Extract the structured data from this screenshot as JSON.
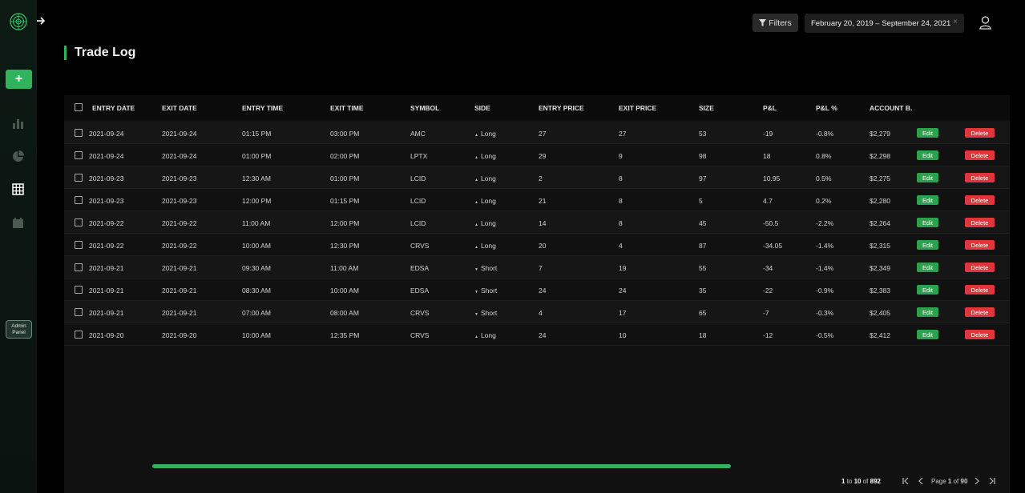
{
  "header": {
    "filters_label": "Filters",
    "date_range": "February 20, 2019 – September 24, 2021",
    "clear_symbol": "×"
  },
  "sidebar": {
    "add_label": "+",
    "admin_label": "Admin Panel",
    "icons": [
      "bar-chart-icon",
      "pie-chart-icon",
      "table-grid-icon",
      "calendar-icon"
    ]
  },
  "page": {
    "title": "Trade Log"
  },
  "table": {
    "columns": [
      "ENTRY DATE",
      "EXIT DATE",
      "ENTRY TIME",
      "EXIT TIME",
      "SYMBOL",
      "SIDE",
      "ENTRY PRICE",
      "EXIT PRICE",
      "SIZE",
      "P&L",
      "P&L %",
      "ACCOUNT B."
    ],
    "edit_label": "Edit",
    "delete_label": "Delete",
    "rows": [
      {
        "entry_date": "2021-09-24",
        "exit_date": "2021-09-24",
        "entry_time": "01:15 PM",
        "exit_time": "03:00 PM",
        "symbol": "AMC",
        "side_mark": "▲",
        "side": "Long",
        "entry_price": "27",
        "exit_price": "27",
        "size": "53",
        "pnl": "-19",
        "pnl_pct": "-0.8%",
        "account": "$2,279"
      },
      {
        "entry_date": "2021-09-24",
        "exit_date": "2021-09-24",
        "entry_time": "01:00 PM",
        "exit_time": "02:00 PM",
        "symbol": "LPTX",
        "side_mark": "▲",
        "side": "Long",
        "entry_price": "29",
        "exit_price": "9",
        "size": "98",
        "pnl": "18",
        "pnl_pct": "0.8%",
        "account": "$2,298"
      },
      {
        "entry_date": "2021-09-23",
        "exit_date": "2021-09-23",
        "entry_time": "12:30 AM",
        "exit_time": "01:00 PM",
        "symbol": "LCID",
        "side_mark": "▲",
        "side": "Long",
        "entry_price": "2",
        "exit_price": "8",
        "size": "97",
        "pnl": "10.95",
        "pnl_pct": "0.5%",
        "account": "$2,275"
      },
      {
        "entry_date": "2021-09-23",
        "exit_date": "2021-09-23",
        "entry_time": "12:00 PM",
        "exit_time": "01:15 PM",
        "symbol": "LCID",
        "side_mark": "▲",
        "side": "Long",
        "entry_price": "21",
        "exit_price": "8",
        "size": "5",
        "pnl": "4.7",
        "pnl_pct": "0.2%",
        "account": "$2,280"
      },
      {
        "entry_date": "2021-09-22",
        "exit_date": "2021-09-22",
        "entry_time": "11:00 AM",
        "exit_time": "12:00 PM",
        "symbol": "LCID",
        "side_mark": "▲",
        "side": "Long",
        "entry_price": "14",
        "exit_price": "8",
        "size": "45",
        "pnl": "-50.5",
        "pnl_pct": "-2.2%",
        "account": "$2,264"
      },
      {
        "entry_date": "2021-09-22",
        "exit_date": "2021-09-22",
        "entry_time": "10:00 AM",
        "exit_time": "12:30 PM",
        "symbol": "CRVS",
        "side_mark": "▲",
        "side": "Long",
        "entry_price": "20",
        "exit_price": "4",
        "size": "87",
        "pnl": "-34.05",
        "pnl_pct": "-1.4%",
        "account": "$2,315"
      },
      {
        "entry_date": "2021-09-21",
        "exit_date": "2021-09-21",
        "entry_time": "09:30 AM",
        "exit_time": "11:00 AM",
        "symbol": "EDSA",
        "side_mark": "▼",
        "side": "Short",
        "entry_price": "7",
        "exit_price": "19",
        "size": "55",
        "pnl": "-34",
        "pnl_pct": "-1.4%",
        "account": "$2,349"
      },
      {
        "entry_date": "2021-09-21",
        "exit_date": "2021-09-21",
        "entry_time": "08:30 AM",
        "exit_time": "10:00 AM",
        "symbol": "EDSA",
        "side_mark": "▼",
        "side": "Short",
        "entry_price": "24",
        "exit_price": "24",
        "size": "35",
        "pnl": "-22",
        "pnl_pct": "-0.9%",
        "account": "$2,383"
      },
      {
        "entry_date": "2021-09-21",
        "exit_date": "2021-09-21",
        "entry_time": "07:00 AM",
        "exit_time": "08:00 AM",
        "symbol": "CRVS",
        "side_mark": "▼",
        "side": "Short",
        "entry_price": "4",
        "exit_price": "17",
        "size": "65",
        "pnl": "-7",
        "pnl_pct": "-0.3%",
        "account": "$2,405"
      },
      {
        "entry_date": "2021-09-20",
        "exit_date": "2021-09-20",
        "entry_time": "10:00 AM",
        "exit_time": "12:35 PM",
        "symbol": "CRVS",
        "side_mark": "▲",
        "side": "Long",
        "entry_price": "24",
        "exit_price": "10",
        "size": "18",
        "pnl": "-12",
        "pnl_pct": "-0.5%",
        "account": "$2,412"
      }
    ]
  },
  "pagination": {
    "from": "1",
    "to_word": "to",
    "to": "10",
    "of_word": "of",
    "total": "892",
    "page_label": "Page",
    "current_page": "1",
    "total_pages": "90",
    "first_icon": "first-page-icon",
    "prev_icon": "prev-page-icon",
    "next_icon": "next-page-icon",
    "last_icon": "last-page-icon"
  },
  "colors": {
    "accent": "#2fb45d",
    "edit": "#2ca24f",
    "delete": "#e0353b"
  }
}
